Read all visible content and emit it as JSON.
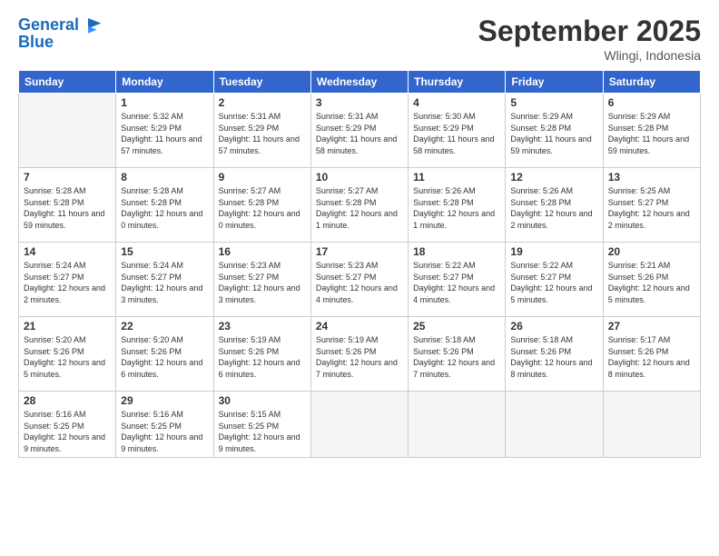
{
  "header": {
    "logo_line1": "General",
    "logo_line2": "Blue",
    "month": "September 2025",
    "location": "Wlingi, Indonesia"
  },
  "days_of_week": [
    "Sunday",
    "Monday",
    "Tuesday",
    "Wednesday",
    "Thursday",
    "Friday",
    "Saturday"
  ],
  "weeks": [
    [
      {
        "day": "",
        "empty": true
      },
      {
        "day": "1",
        "sunrise": "5:32 AM",
        "sunset": "5:29 PM",
        "daylight": "11 hours and 57 minutes."
      },
      {
        "day": "2",
        "sunrise": "5:31 AM",
        "sunset": "5:29 PM",
        "daylight": "11 hours and 57 minutes."
      },
      {
        "day": "3",
        "sunrise": "5:31 AM",
        "sunset": "5:29 PM",
        "daylight": "11 hours and 58 minutes."
      },
      {
        "day": "4",
        "sunrise": "5:30 AM",
        "sunset": "5:29 PM",
        "daylight": "11 hours and 58 minutes."
      },
      {
        "day": "5",
        "sunrise": "5:29 AM",
        "sunset": "5:28 PM",
        "daylight": "11 hours and 59 minutes."
      },
      {
        "day": "6",
        "sunrise": "5:29 AM",
        "sunset": "5:28 PM",
        "daylight": "11 hours and 59 minutes."
      }
    ],
    [
      {
        "day": "7",
        "sunrise": "5:28 AM",
        "sunset": "5:28 PM",
        "daylight": "11 hours and 59 minutes."
      },
      {
        "day": "8",
        "sunrise": "5:28 AM",
        "sunset": "5:28 PM",
        "daylight": "12 hours and 0 minutes."
      },
      {
        "day": "9",
        "sunrise": "5:27 AM",
        "sunset": "5:28 PM",
        "daylight": "12 hours and 0 minutes."
      },
      {
        "day": "10",
        "sunrise": "5:27 AM",
        "sunset": "5:28 PM",
        "daylight": "12 hours and 1 minute."
      },
      {
        "day": "11",
        "sunrise": "5:26 AM",
        "sunset": "5:28 PM",
        "daylight": "12 hours and 1 minute."
      },
      {
        "day": "12",
        "sunrise": "5:26 AM",
        "sunset": "5:28 PM",
        "daylight": "12 hours and 2 minutes."
      },
      {
        "day": "13",
        "sunrise": "5:25 AM",
        "sunset": "5:27 PM",
        "daylight": "12 hours and 2 minutes."
      }
    ],
    [
      {
        "day": "14",
        "sunrise": "5:24 AM",
        "sunset": "5:27 PM",
        "daylight": "12 hours and 2 minutes."
      },
      {
        "day": "15",
        "sunrise": "5:24 AM",
        "sunset": "5:27 PM",
        "daylight": "12 hours and 3 minutes."
      },
      {
        "day": "16",
        "sunrise": "5:23 AM",
        "sunset": "5:27 PM",
        "daylight": "12 hours and 3 minutes."
      },
      {
        "day": "17",
        "sunrise": "5:23 AM",
        "sunset": "5:27 PM",
        "daylight": "12 hours and 4 minutes."
      },
      {
        "day": "18",
        "sunrise": "5:22 AM",
        "sunset": "5:27 PM",
        "daylight": "12 hours and 4 minutes."
      },
      {
        "day": "19",
        "sunrise": "5:22 AM",
        "sunset": "5:27 PM",
        "daylight": "12 hours and 5 minutes."
      },
      {
        "day": "20",
        "sunrise": "5:21 AM",
        "sunset": "5:26 PM",
        "daylight": "12 hours and 5 minutes."
      }
    ],
    [
      {
        "day": "21",
        "sunrise": "5:20 AM",
        "sunset": "5:26 PM",
        "daylight": "12 hours and 5 minutes."
      },
      {
        "day": "22",
        "sunrise": "5:20 AM",
        "sunset": "5:26 PM",
        "daylight": "12 hours and 6 minutes."
      },
      {
        "day": "23",
        "sunrise": "5:19 AM",
        "sunset": "5:26 PM",
        "daylight": "12 hours and 6 minutes."
      },
      {
        "day": "24",
        "sunrise": "5:19 AM",
        "sunset": "5:26 PM",
        "daylight": "12 hours and 7 minutes."
      },
      {
        "day": "25",
        "sunrise": "5:18 AM",
        "sunset": "5:26 PM",
        "daylight": "12 hours and 7 minutes."
      },
      {
        "day": "26",
        "sunrise": "5:18 AM",
        "sunset": "5:26 PM",
        "daylight": "12 hours and 8 minutes."
      },
      {
        "day": "27",
        "sunrise": "5:17 AM",
        "sunset": "5:26 PM",
        "daylight": "12 hours and 8 minutes."
      }
    ],
    [
      {
        "day": "28",
        "sunrise": "5:16 AM",
        "sunset": "5:25 PM",
        "daylight": "12 hours and 9 minutes."
      },
      {
        "day": "29",
        "sunrise": "5:16 AM",
        "sunset": "5:25 PM",
        "daylight": "12 hours and 9 minutes."
      },
      {
        "day": "30",
        "sunrise": "5:15 AM",
        "sunset": "5:25 PM",
        "daylight": "12 hours and 9 minutes."
      },
      {
        "day": "",
        "empty": true
      },
      {
        "day": "",
        "empty": true
      },
      {
        "day": "",
        "empty": true
      },
      {
        "day": "",
        "empty": true
      }
    ]
  ]
}
